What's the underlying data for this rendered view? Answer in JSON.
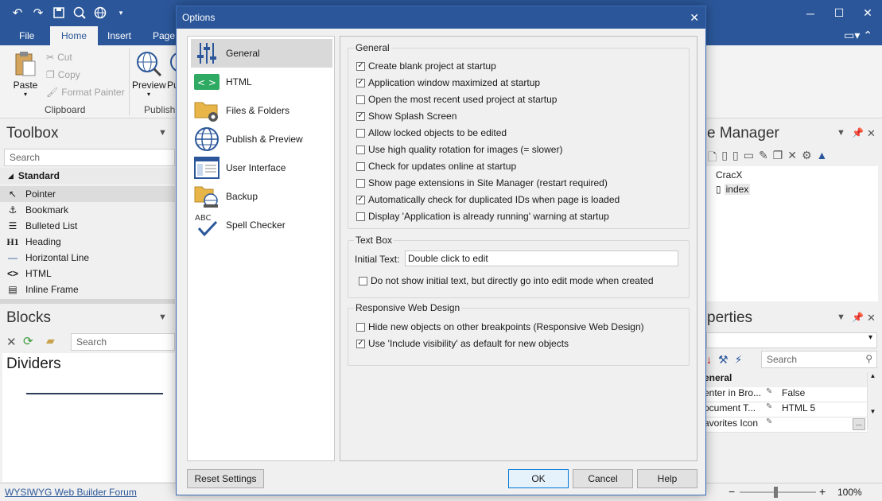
{
  "app": {
    "quick_access": [
      "undo-icon",
      "redo-icon",
      "save-icon",
      "preview-icon",
      "publish-icon",
      "customize-icon"
    ],
    "tabs": [
      "File",
      "Home",
      "Insert",
      "Page"
    ],
    "window_controls": {
      "minimize": "─",
      "maximize": "☐",
      "close": "✕"
    },
    "display_icon": "display-icon",
    "ribbon": {
      "paste": "Paste",
      "cut": "Cut",
      "copy": "Copy",
      "format_painter": "Format Painter",
      "clipboard_group": "Clipboard",
      "preview": "Preview",
      "publish_short": "Pu",
      "publish_group": "Publish"
    }
  },
  "toolbox": {
    "title": "Toolbox",
    "search_placeholder": "Search",
    "category": "Standard",
    "items": [
      {
        "label": "Pointer",
        "icon": "↖"
      },
      {
        "label": "Bookmark",
        "icon": "⚓"
      },
      {
        "label": "Bulleted List",
        "icon": "☰"
      },
      {
        "label": "Heading",
        "icon": "H1"
      },
      {
        "label": "Horizontal Line",
        "icon": "—"
      },
      {
        "label": "HTML",
        "icon": "<>"
      },
      {
        "label": "Inline Frame",
        "icon": "▤"
      }
    ]
  },
  "blocks": {
    "title": "Blocks",
    "search_placeholder": "Search",
    "section": "Dividers"
  },
  "site_manager": {
    "title_fragment": "e Manager",
    "root": "CracX",
    "page": "index"
  },
  "properties": {
    "title_fragment": "perties",
    "search_placeholder": "Search",
    "section": "eneral",
    "rows": [
      {
        "name": "enter in Bro...",
        "value": "False"
      },
      {
        "name": "ocument T...",
        "value": "HTML 5"
      },
      {
        "name": "avorites Icon",
        "value": ""
      }
    ],
    "ellipsis": "..."
  },
  "status": {
    "forum_link": "WYSIWYG Web Builder Forum",
    "zoom_minus": "−",
    "zoom_plus": "+",
    "zoom": "100%"
  },
  "dialog": {
    "title": "Options",
    "nav": [
      {
        "label": "General",
        "icon": "sliders-icon",
        "selected": true
      },
      {
        "label": "HTML",
        "icon": "html-code-icon",
        "selected": false
      },
      {
        "label": "Files & Folders",
        "icon": "folder-gear-icon",
        "selected": false
      },
      {
        "label": "Publish & Preview",
        "icon": "globe-icon",
        "selected": false
      },
      {
        "label": "User Interface",
        "icon": "window-icon",
        "selected": false
      },
      {
        "label": "Backup",
        "icon": "backup-icon",
        "selected": false
      },
      {
        "label": "Spell Checker",
        "icon": "spell-check-icon",
        "selected": false
      }
    ],
    "general": {
      "legend": "General",
      "options": [
        {
          "label": "Create blank project at startup",
          "checked": true
        },
        {
          "label": "Application window maximized at startup",
          "checked": true
        },
        {
          "label": "Open the most recent used project at startup",
          "checked": false
        },
        {
          "label": "Show Splash Screen",
          "checked": true
        },
        {
          "label": "Allow locked objects to be edited",
          "checked": false
        },
        {
          "label": "Use high quality rotation for images (= slower)",
          "checked": false
        },
        {
          "label": "Check for updates online at startup",
          "checked": false
        },
        {
          "label": "Show page extensions in Site Manager (restart required)",
          "checked": false
        },
        {
          "label": "Automatically check for duplicated IDs when page is loaded",
          "checked": true
        },
        {
          "label": "Display 'Application is already running' warning at startup",
          "checked": false
        }
      ]
    },
    "textbox": {
      "legend": "Text Box",
      "initial_text_label": "Initial Text:",
      "initial_text_value": "Double click to edit",
      "option": {
        "label": "Do not show initial text, but directly go into edit mode when created",
        "checked": false
      }
    },
    "responsive": {
      "legend": "Responsive Web Design",
      "options": [
        {
          "label": "Hide new objects on other breakpoints (Responsive Web Design)",
          "checked": false
        },
        {
          "label": "Use 'Include visibility' as default for new objects",
          "checked": true
        }
      ]
    },
    "buttons": {
      "reset": "Reset Settings",
      "ok": "OK",
      "cancel": "Cancel",
      "help": "Help"
    }
  }
}
